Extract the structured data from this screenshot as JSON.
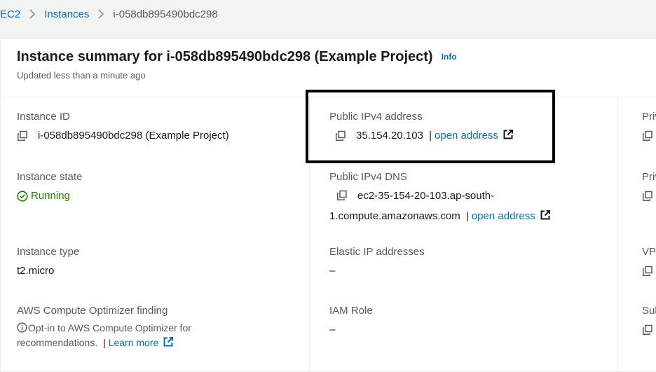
{
  "breadcrumb": {
    "items": [
      "EC2",
      "Instances"
    ],
    "current": "i-058db895490bdc298"
  },
  "summary": {
    "title": "Instance summary for i-058db895490bdc298 (Example Project)",
    "info_label": "Info",
    "updated": "Updated less than a minute ago"
  },
  "fields": {
    "instance_id": {
      "label": "Instance ID",
      "value": "i-058db895490bdc298 (Example Project)"
    },
    "public_ipv4": {
      "label": "Public IPv4 address",
      "value": "35.154.20.103",
      "separator": "|",
      "link": "open address"
    },
    "instance_state": {
      "label": "Instance state",
      "value": "Running"
    },
    "public_dns": {
      "label": "Public IPv4 DNS",
      "value_line1": "ec2-35-154-20-103.ap-south-",
      "value_line2": "1.compute.amazonaws.com",
      "separator": "|",
      "link": "open address"
    },
    "instance_type": {
      "label": "Instance type",
      "value": "t2.micro"
    },
    "elastic_ip": {
      "label": "Elastic IP addresses",
      "value": "–"
    },
    "optimizer": {
      "label": "AWS Compute Optimizer finding",
      "note": "Opt-in to AWS Compute Optimizer for recommendations.",
      "separator": "|",
      "link": "Learn more"
    },
    "iam_role": {
      "label": "IAM Role",
      "value": "–"
    }
  },
  "truncated_column": {
    "labels": [
      "Priv",
      "Priv",
      "VPC",
      "Sub"
    ]
  },
  "colors": {
    "link": "#0073bb",
    "running": "#1d8102",
    "label": "#545b64",
    "highlight_border": "#000000"
  }
}
